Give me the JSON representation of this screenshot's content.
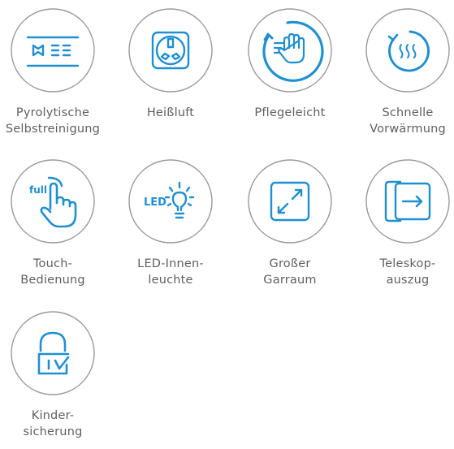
{
  "features": [
    {
      "label": "Pyrolytische\nSelbstreinigung",
      "icon": "pyrolysis-icon"
    },
    {
      "label": "Heißluft",
      "icon": "hot-air-fan-icon"
    },
    {
      "label": "Pflegeleicht",
      "icon": "easy-care-hand-icon"
    },
    {
      "label": "Schnelle\nVorwärmung",
      "icon": "fast-preheat-icon"
    },
    {
      "label": "Touch-\nBedienung",
      "icon": "touch-control-icon"
    },
    {
      "label": "LED-Innen-\nleuchte",
      "icon": "led-light-icon"
    },
    {
      "label": "Großer\nGarraum",
      "icon": "large-cavity-icon"
    },
    {
      "label": "Teleskop-\nauszug",
      "icon": "telescopic-rail-icon"
    },
    {
      "label": "Kinder-\nsicherung",
      "icon": "child-lock-icon"
    }
  ],
  "icon_text": {
    "touch": "full",
    "led": "LED"
  },
  "colors": {
    "accent": "#1f8fd1",
    "circle_border": "#9a9a9a",
    "label": "#5f5f5f"
  }
}
